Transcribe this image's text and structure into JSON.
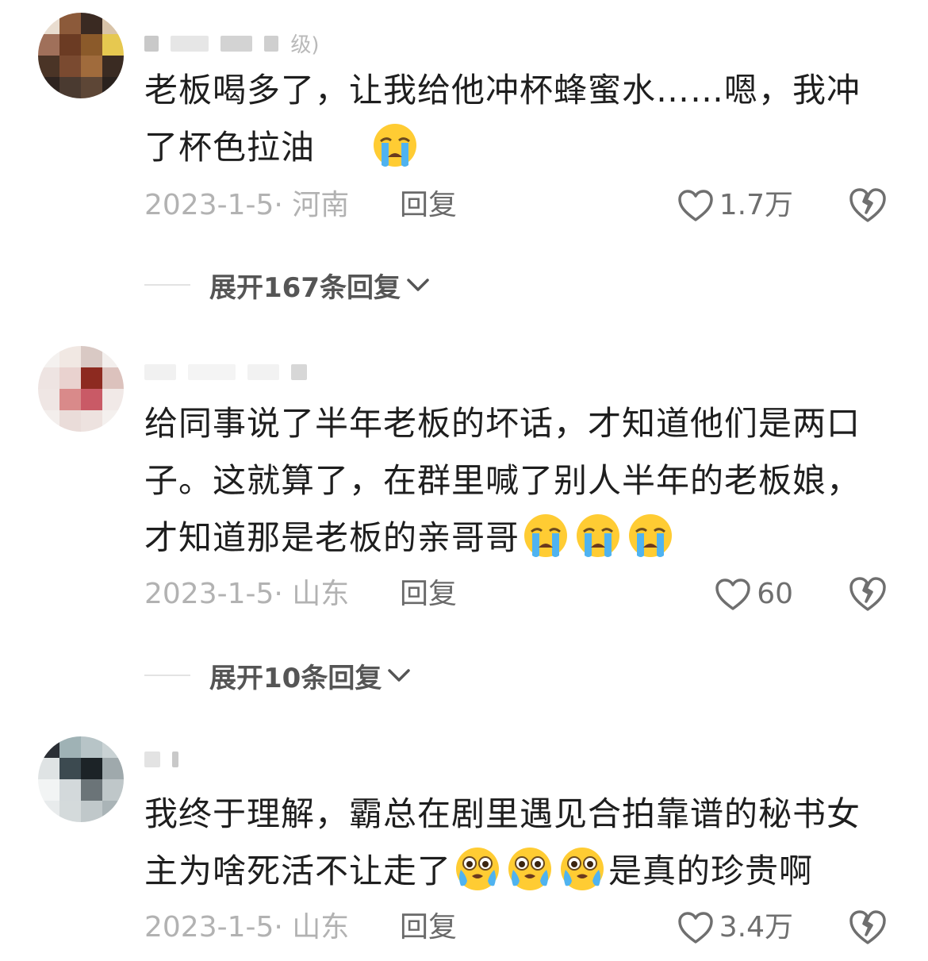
{
  "comments": [
    {
      "username_fragment": "级)",
      "text_line1": "老板喝多了，让我给他冲杯蜂蜜水……嗯，我冲",
      "text_line2": "了杯色拉油",
      "date": "2023-1-5",
      "location": "河南",
      "reply_label": "回复",
      "likes": "1.7万",
      "expand_label": "展开167条回复"
    },
    {
      "username_fragment": "",
      "text_line1": "给同事说了半年老板的坏话，才知道他们是两口",
      "text_line2": "子。这就算了，在群里喊了别人半年的老板娘，",
      "text_line3": "才知道那是老板的亲哥哥",
      "date": "2023-1-5",
      "location": "山东",
      "reply_label": "回复",
      "likes": "60",
      "expand_label": "展开10条回复"
    },
    {
      "username_fragment": "",
      "text_line1": "我终于理解，霸总在剧里遇见合拍靠谱的秘书女",
      "text_line2a": "主为啥死活不让走了",
      "text_line2b": "是真的珍贵啊",
      "date": "2023-1-5",
      "location": "山东",
      "reply_label": "回复",
      "likes": "3.4万"
    }
  ],
  "icons": {
    "like": "heart-outline-icon",
    "dislike": "broken-heart-icon",
    "expand": "chevron-down-icon",
    "emoji_cry": "loudly-crying-face-emoji",
    "emoji_tears": "teary-face-emoji"
  },
  "colors": {
    "text": "#1e1e1e",
    "meta": "#b2b2b2",
    "reply": "#6a6a6a",
    "icon": "#6f6f6f",
    "emoji_yellow": "#ffcc33",
    "emoji_blue": "#4fb3f0"
  }
}
